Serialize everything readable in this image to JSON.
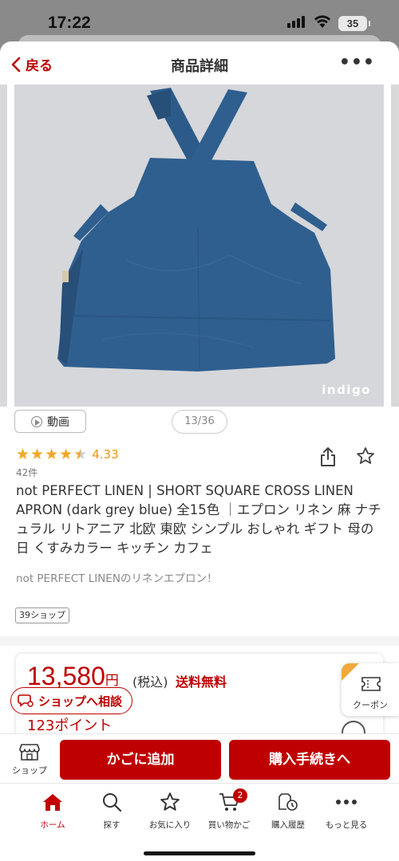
{
  "status_bar": {
    "time": "17:22",
    "battery": "35"
  },
  "nav": {
    "back_label": "戻る",
    "title": "商品詳細",
    "more_label": "•••"
  },
  "gallery": {
    "watermark": "indigo",
    "video_label": "動画",
    "counter": "13/36"
  },
  "product": {
    "rating": 4.33,
    "rating_text": "4.33",
    "review_count": "42件",
    "title": "not PERFECT LINEN | SHORT SQUARE CROSS LINEN APRON (dark grey blue) 全15色 ｜エプロン リネン 麻 ナチュラル リトアニア 北欧 東欧 シンプル おしゃれ ギフト 母の日 くすみカラー キッチン カフェ",
    "catch_copy": "not PERFECT LINENのリネンエプロン！",
    "shop_tag": "39ショップ"
  },
  "price": {
    "amount": "13,580",
    "yen": "円",
    "tax": "(税込)",
    "shipping": "送料無料",
    "points": "123ポイント"
  },
  "consult_label": "ショップへ相談",
  "coupon_label": "クーポン",
  "actions": {
    "shop_label": "ショップ",
    "cart_label": "かごに追加",
    "buy_label": "購入手続きへ"
  },
  "tabbar": {
    "items": [
      {
        "label": "ホーム",
        "icon": "home-icon",
        "active": true
      },
      {
        "label": "探す",
        "icon": "search-icon"
      },
      {
        "label": "お気に入り",
        "icon": "star-icon"
      },
      {
        "label": "買い物かご",
        "icon": "cart-icon",
        "badge": "2"
      },
      {
        "label": "購入履歴",
        "icon": "history-icon"
      },
      {
        "label": "もっと見る",
        "icon": "more-icon"
      }
    ]
  },
  "colors": {
    "accent": "#bf0000",
    "rating": "#f5a623",
    "apron": "#2f5f8f"
  }
}
